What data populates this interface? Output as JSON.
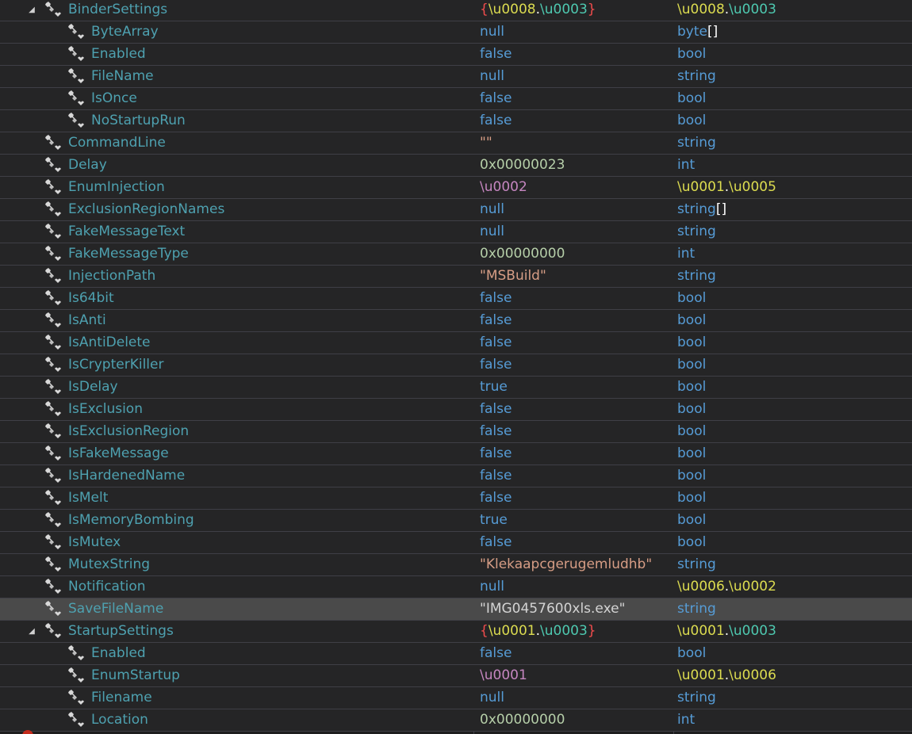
{
  "window": {
    "title": ""
  },
  "colors": {
    "background": "#1e1e1e",
    "row_background": "#252526",
    "row_selected": "#4a4a4a",
    "grid_line": "#3f3f46",
    "name_text": "#4ea1b0",
    "keyword": "#569cd6",
    "number": "#b5cea8",
    "string": "#d69d85",
    "type_yellow": "#dcdc50",
    "type_cyan": "#4ec9b0",
    "enum_magenta": "#c586c0"
  },
  "rows": [
    {
      "name": "BinderSettings",
      "level": 1,
      "expanded": true,
      "selected": false,
      "value": [
        {
          "t": "{",
          "k": "red"
        },
        {
          "t": "\\u0008",
          "k": "yellow"
        },
        {
          "t": ".",
          "k": "white"
        },
        {
          "t": "\\u0003",
          "k": "cyan"
        },
        {
          "t": "}",
          "k": "red"
        }
      ],
      "type": [
        {
          "t": "\\u0008",
          "k": "yellow"
        },
        {
          "t": ".",
          "k": "white"
        },
        {
          "t": "\\u0003",
          "k": "cyan"
        }
      ]
    },
    {
      "name": "ByteArray",
      "level": 2,
      "value": [
        {
          "t": "null",
          "k": "kw"
        }
      ],
      "type": [
        {
          "t": "byte",
          "k": "kw"
        },
        {
          "t": "[]",
          "k": "white"
        }
      ]
    },
    {
      "name": "Enabled",
      "level": 2,
      "value": [
        {
          "t": "false",
          "k": "kw"
        }
      ],
      "type": [
        {
          "t": "bool",
          "k": "kw"
        }
      ]
    },
    {
      "name": "FileName",
      "level": 2,
      "value": [
        {
          "t": "null",
          "k": "kw"
        }
      ],
      "type": [
        {
          "t": "string",
          "k": "kw"
        }
      ]
    },
    {
      "name": "IsOnce",
      "level": 2,
      "value": [
        {
          "t": "false",
          "k": "kw"
        }
      ],
      "type": [
        {
          "t": "bool",
          "k": "kw"
        }
      ]
    },
    {
      "name": "NoStartupRun",
      "level": 2,
      "value": [
        {
          "t": "false",
          "k": "kw"
        }
      ],
      "type": [
        {
          "t": "bool",
          "k": "kw"
        }
      ]
    },
    {
      "name": "CommandLine",
      "level": 1,
      "value": [
        {
          "t": "\"\"",
          "k": "str"
        }
      ],
      "type": [
        {
          "t": "string",
          "k": "kw"
        }
      ]
    },
    {
      "name": "Delay",
      "level": 1,
      "value": [
        {
          "t": "0x00000023",
          "k": "num"
        }
      ],
      "type": [
        {
          "t": "int",
          "k": "kw"
        }
      ]
    },
    {
      "name": "EnumInjection",
      "level": 1,
      "value": [
        {
          "t": "\\u0002",
          "k": "magenta"
        }
      ],
      "type": [
        {
          "t": "\\u0001",
          "k": "yellow"
        },
        {
          "t": ".",
          "k": "white"
        },
        {
          "t": "\\u0005",
          "k": "yellow"
        }
      ]
    },
    {
      "name": "ExclusionRegionNames",
      "level": 1,
      "value": [
        {
          "t": "null",
          "k": "kw"
        }
      ],
      "type": [
        {
          "t": "string",
          "k": "kw"
        },
        {
          "t": "[]",
          "k": "white"
        }
      ]
    },
    {
      "name": "FakeMessageText",
      "level": 1,
      "value": [
        {
          "t": "null",
          "k": "kw"
        }
      ],
      "type": [
        {
          "t": "string",
          "k": "kw"
        }
      ]
    },
    {
      "name": "FakeMessageType",
      "level": 1,
      "value": [
        {
          "t": "0x00000000",
          "k": "num"
        }
      ],
      "type": [
        {
          "t": "int",
          "k": "kw"
        }
      ]
    },
    {
      "name": "InjectionPath",
      "level": 1,
      "value": [
        {
          "t": "\"MSBuild\"",
          "k": "str"
        }
      ],
      "type": [
        {
          "t": "string",
          "k": "kw"
        }
      ]
    },
    {
      "name": "Is64bit",
      "level": 1,
      "value": [
        {
          "t": "false",
          "k": "kw"
        }
      ],
      "type": [
        {
          "t": "bool",
          "k": "kw"
        }
      ]
    },
    {
      "name": "IsAnti",
      "level": 1,
      "value": [
        {
          "t": "false",
          "k": "kw"
        }
      ],
      "type": [
        {
          "t": "bool",
          "k": "kw"
        }
      ]
    },
    {
      "name": "IsAntiDelete",
      "level": 1,
      "value": [
        {
          "t": "false",
          "k": "kw"
        }
      ],
      "type": [
        {
          "t": "bool",
          "k": "kw"
        }
      ]
    },
    {
      "name": "IsCrypterKiller",
      "level": 1,
      "value": [
        {
          "t": "false",
          "k": "kw"
        }
      ],
      "type": [
        {
          "t": "bool",
          "k": "kw"
        }
      ]
    },
    {
      "name": "IsDelay",
      "level": 1,
      "value": [
        {
          "t": "true",
          "k": "kw"
        }
      ],
      "type": [
        {
          "t": "bool",
          "k": "kw"
        }
      ]
    },
    {
      "name": "IsExclusion",
      "level": 1,
      "value": [
        {
          "t": "false",
          "k": "kw"
        }
      ],
      "type": [
        {
          "t": "bool",
          "k": "kw"
        }
      ]
    },
    {
      "name": "IsExclusionRegion",
      "level": 1,
      "value": [
        {
          "t": "false",
          "k": "kw"
        }
      ],
      "type": [
        {
          "t": "bool",
          "k": "kw"
        }
      ]
    },
    {
      "name": "IsFakeMessage",
      "level": 1,
      "value": [
        {
          "t": "false",
          "k": "kw"
        }
      ],
      "type": [
        {
          "t": "bool",
          "k": "kw"
        }
      ]
    },
    {
      "name": "IsHardenedName",
      "level": 1,
      "value": [
        {
          "t": "false",
          "k": "kw"
        }
      ],
      "type": [
        {
          "t": "bool",
          "k": "kw"
        }
      ]
    },
    {
      "name": "IsMelt",
      "level": 1,
      "value": [
        {
          "t": "false",
          "k": "kw"
        }
      ],
      "type": [
        {
          "t": "bool",
          "k": "kw"
        }
      ]
    },
    {
      "name": "IsMemoryBombing",
      "level": 1,
      "value": [
        {
          "t": "true",
          "k": "kw"
        }
      ],
      "type": [
        {
          "t": "bool",
          "k": "kw"
        }
      ]
    },
    {
      "name": "IsMutex",
      "level": 1,
      "value": [
        {
          "t": "false",
          "k": "kw"
        }
      ],
      "type": [
        {
          "t": "bool",
          "k": "kw"
        }
      ]
    },
    {
      "name": "MutexString",
      "level": 1,
      "value": [
        {
          "t": "\"Klekaapcgerugemludhb\"",
          "k": "str"
        }
      ],
      "type": [
        {
          "t": "string",
          "k": "kw"
        }
      ]
    },
    {
      "name": "Notification",
      "level": 1,
      "value": [
        {
          "t": "null",
          "k": "kw"
        }
      ],
      "type": [
        {
          "t": "\\u0006",
          "k": "yellow"
        },
        {
          "t": ".",
          "k": "white"
        },
        {
          "t": "\\u0002",
          "k": "yellow"
        }
      ]
    },
    {
      "name": "SaveFileName",
      "level": 1,
      "selected": true,
      "value": [
        {
          "t": "\"IMG0457600xls.exe\"",
          "k": "plain"
        }
      ],
      "type": [
        {
          "t": "string",
          "k": "kw"
        }
      ]
    },
    {
      "name": "StartupSettings",
      "level": 1,
      "expanded": true,
      "value": [
        {
          "t": "{",
          "k": "red"
        },
        {
          "t": "\\u0001",
          "k": "yellow"
        },
        {
          "t": ".",
          "k": "white"
        },
        {
          "t": "\\u0003",
          "k": "cyan"
        },
        {
          "t": "}",
          "k": "red"
        }
      ],
      "type": [
        {
          "t": "\\u0001",
          "k": "yellow"
        },
        {
          "t": ".",
          "k": "white"
        },
        {
          "t": "\\u0003",
          "k": "cyan"
        }
      ]
    },
    {
      "name": "Enabled",
      "level": 2,
      "value": [
        {
          "t": "false",
          "k": "kw"
        }
      ],
      "type": [
        {
          "t": "bool",
          "k": "kw"
        }
      ]
    },
    {
      "name": "EnumStartup",
      "level": 2,
      "value": [
        {
          "t": "\\u0001",
          "k": "magenta"
        }
      ],
      "type": [
        {
          "t": "\\u0001",
          "k": "yellow"
        },
        {
          "t": ".",
          "k": "white"
        },
        {
          "t": "\\u0006",
          "k": "yellow"
        }
      ]
    },
    {
      "name": "Filename",
      "level": 2,
      "value": [
        {
          "t": "null",
          "k": "kw"
        }
      ],
      "type": [
        {
          "t": "string",
          "k": "kw"
        }
      ]
    },
    {
      "name": "Location",
      "level": 2,
      "value": [
        {
          "t": "0x00000000",
          "k": "num"
        }
      ],
      "type": [
        {
          "t": "int",
          "k": "kw"
        }
      ]
    }
  ]
}
